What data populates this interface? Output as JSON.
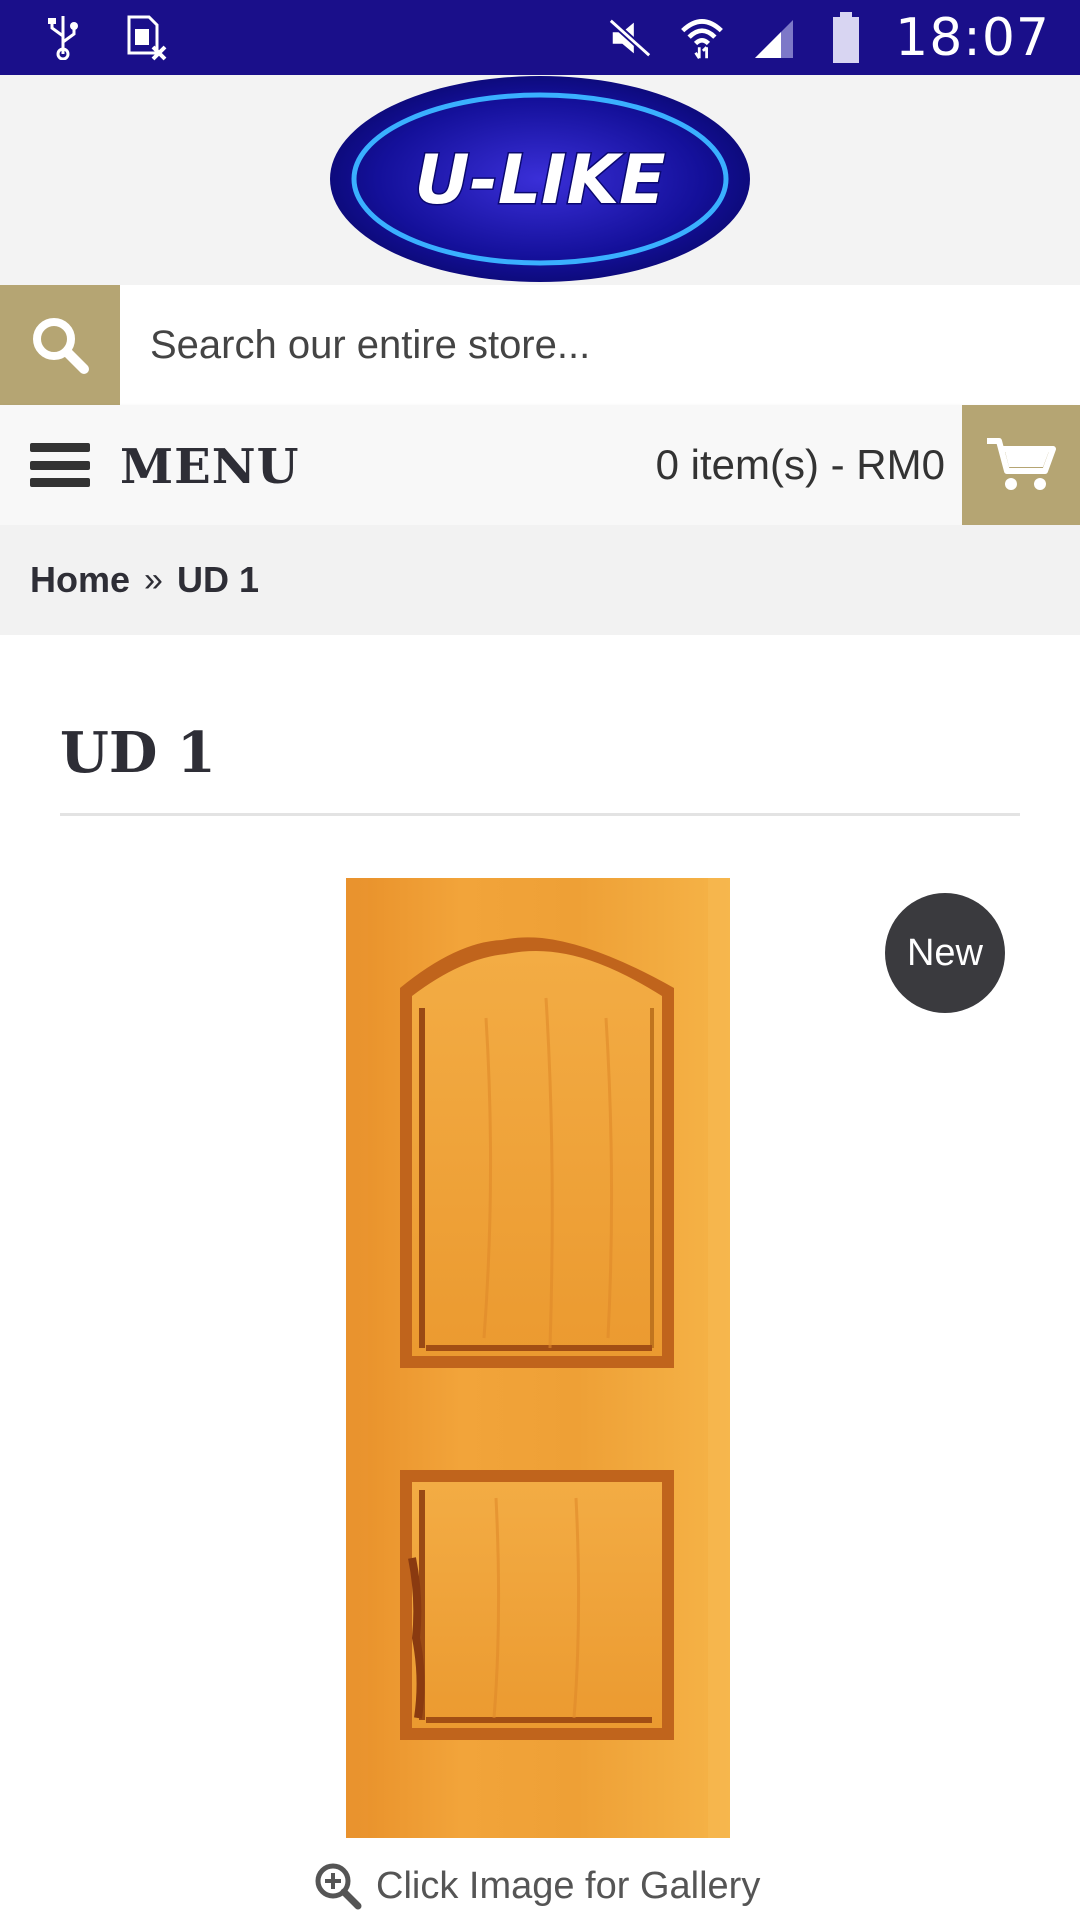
{
  "status_bar": {
    "time": "18:07",
    "background": "#1a0f8a",
    "icons": [
      "usb-icon",
      "sim-off-icon",
      "mute-icon",
      "wifi-icon",
      "signal-icon",
      "battery-icon"
    ]
  },
  "header": {
    "logo_text": "U-LIKE",
    "logo_colors": {
      "outer": "#1b0f9c",
      "inner": "#0a0a7a",
      "ring": "#3ab0ff"
    }
  },
  "search": {
    "placeholder": "Search our entire store...",
    "button_icon": "search-icon",
    "accent": "#b5a573"
  },
  "menubar": {
    "menu_label": "MENU",
    "menu_icon": "hamburger-icon",
    "cart_summary": "0 item(s) - RM0",
    "cart_icon": "cart-icon"
  },
  "breadcrumb": {
    "items": [
      "Home",
      "UD 1"
    ],
    "separator": "»"
  },
  "product": {
    "title": "UD 1",
    "badge": "New",
    "gallery_link": "Click Image for Gallery",
    "gallery_icon": "zoom-in-icon"
  }
}
